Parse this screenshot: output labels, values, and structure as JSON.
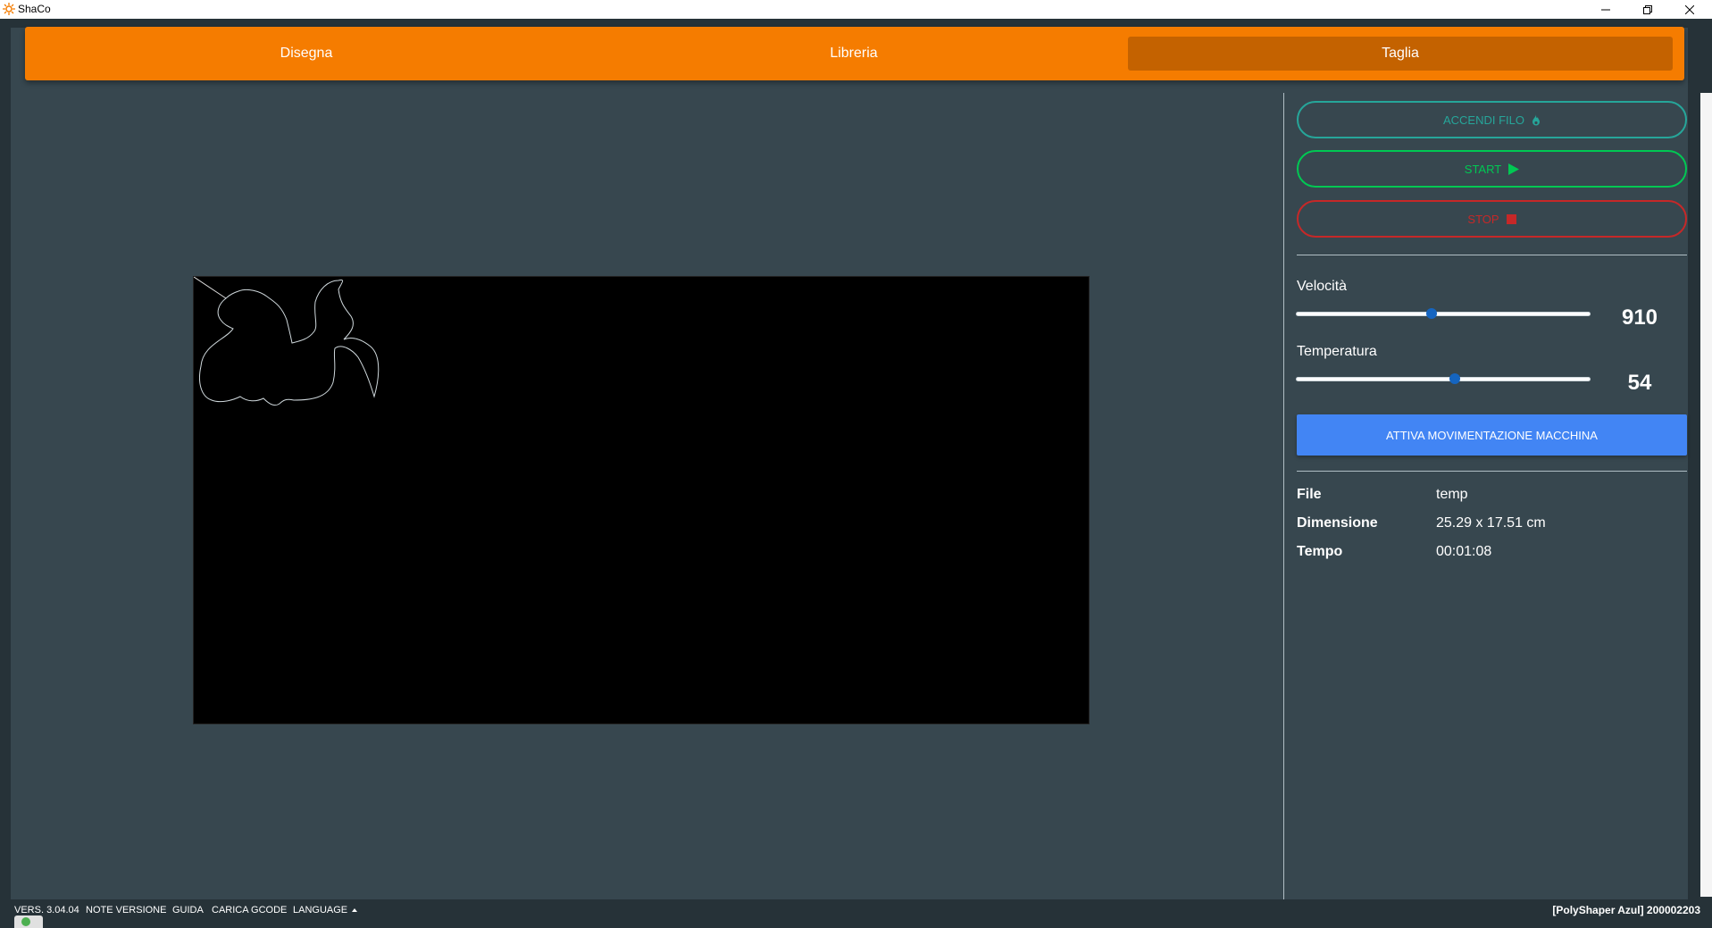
{
  "window": {
    "title": "ShaCo",
    "minimize_icon": "minimize-icon",
    "maximize_icon": "restore-icon",
    "close_icon": "close-icon"
  },
  "nav": {
    "tabs": [
      {
        "label": "Disegna"
      },
      {
        "label": "Libreria"
      },
      {
        "label": "Taglia",
        "active": true
      }
    ],
    "accent": "#f57c00",
    "active_bg": "#c46200"
  },
  "controls": {
    "accendi_label": "ACCENDI FILO",
    "accendi_icon": "flame-icon",
    "start_label": "START",
    "start_icon": "play-icon",
    "stop_label": "STOP",
    "stop_icon": "stop-square-icon",
    "colors": {
      "accendi": "#26a69a",
      "start": "#00c853",
      "stop": "#c62828",
      "attiva": "#4285f4"
    }
  },
  "sliders": {
    "velocita": {
      "label": "Velocità",
      "value": "910",
      "fraction": 0.46
    },
    "temperatura": {
      "label": "Temperatura",
      "value": "54",
      "fraction": 0.54
    }
  },
  "attiva_label": "ATTIVA MOVIMENTAZIONE MACCHINA",
  "info": {
    "file_key": "File",
    "file_val": "temp",
    "dim_key": "Dimensione",
    "dim_val": "25.29 x 17.51 cm",
    "tempo_key": "Tempo",
    "tempo_val": "00:01:08"
  },
  "footer": {
    "version": "VERS. 3.04.04",
    "notes": "NOTE VERSIONE",
    "guide": "GUIDA",
    "gcode": "CARICA GCODE",
    "language": "LANGUAGE",
    "language_icon": "caret-up-icon",
    "device": "[PolyShaper Azul] 200002203"
  }
}
